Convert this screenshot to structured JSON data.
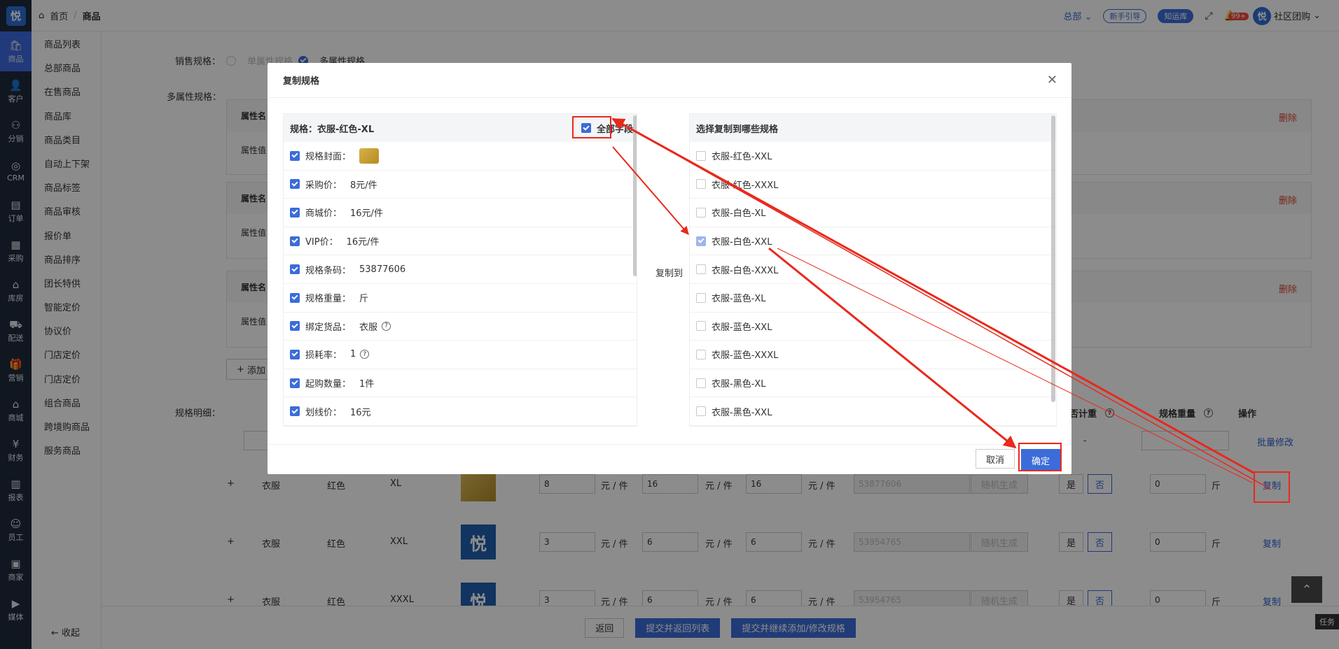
{
  "rail": {
    "logo": "悦",
    "items": [
      {
        "icon": "🛍",
        "label": "商品",
        "active": true
      },
      {
        "icon": "👤",
        "label": "客户"
      },
      {
        "icon": "⚇",
        "label": "分销"
      },
      {
        "icon": "◎",
        "label": "CRM"
      },
      {
        "icon": "▤",
        "label": "订单"
      },
      {
        "icon": "▦",
        "label": "采购"
      },
      {
        "icon": "⌂",
        "label": "库房"
      },
      {
        "icon": "⛟",
        "label": "配送"
      },
      {
        "icon": "🎁",
        "label": "营销"
      },
      {
        "icon": "⌂",
        "label": "商城"
      },
      {
        "icon": "¥",
        "label": "财务"
      },
      {
        "icon": "▥",
        "label": "报表"
      },
      {
        "icon": "☺",
        "label": "员工"
      },
      {
        "icon": "▣",
        "label": "商家"
      },
      {
        "icon": "▶",
        "label": "媒体"
      }
    ]
  },
  "subnav": {
    "items": [
      "商品列表",
      "总部商品",
      "在售商品",
      "商品库",
      "商品类目",
      "自动上下架",
      "商品标签",
      "商品审核",
      "报价单",
      "商品排序",
      "团长特供",
      "智能定价",
      "协议价",
      "门店定价",
      "门店定价",
      "组合商品",
      "跨境购商品",
      "服务商品"
    ],
    "collapse": "收起"
  },
  "topbar": {
    "crumb_home": "首页",
    "crumb_sep": "/",
    "crumb_current": "商品",
    "hq": "总部",
    "guide": "新手引导",
    "knowledge": "知运库",
    "badge": "99+",
    "store": "社区团购"
  },
  "form": {
    "sale_spec_label": "销售规格：",
    "single": "单属性规格",
    "multi": "多属性规格",
    "multi_label": "多属性规格：",
    "attr_name": "属性名",
    "attr_value": "属性值",
    "delete": "删除",
    "add": "添加",
    "detail_label": "规格明细：",
    "col_weight_by": "否计重",
    "col_weight": "规格重量",
    "col_ops": "操作",
    "batch": "批量修改"
  },
  "rows": [
    {
      "name": "衣服",
      "color": "红色",
      "size": "XL",
      "p1": "8",
      "p2": "16",
      "p3": "16",
      "unit": "元 / 件",
      "code": "53877606",
      "gen": "随机生成",
      "yes": "是",
      "no": "否",
      "weight": "0",
      "wunit": "斤",
      "op": "复制"
    },
    {
      "name": "衣服",
      "color": "红色",
      "size": "XXL",
      "p1": "3",
      "p2": "6",
      "p3": "6",
      "unit": "元 / 件",
      "code": "53954765",
      "gen": "随机生成",
      "yes": "是",
      "no": "否",
      "weight": "0",
      "wunit": "斤",
      "op": "复制"
    },
    {
      "name": "衣服",
      "color": "红色",
      "size": "XXXL",
      "p1": "3",
      "p2": "6",
      "p3": "6",
      "unit": "元 / 件",
      "code": "53954765",
      "gen": "随机生成",
      "yes": "是",
      "no": "否",
      "weight": "0",
      "wunit": "斤",
      "op": "复制"
    }
  ],
  "plus": "+",
  "dash": "-",
  "bottom": {
    "back": "返回",
    "submit_list": "提交并返回列表",
    "submit_continue": "提交并继续添加/修改规格"
  },
  "task": "任务",
  "dialog": {
    "title": "复制规格",
    "left_header": "规格：衣服-红色-XL",
    "all_fields": "全部字段",
    "copy_to": "复制到",
    "right_header": "选择复制到哪些规格",
    "fields": [
      {
        "label": "规格封面：",
        "value": "",
        "thumb": true
      },
      {
        "label": "采购价：",
        "value": "8元/件"
      },
      {
        "label": "商城价：",
        "value": "16元/件"
      },
      {
        "label": "VIP价：",
        "value": "16元/件"
      },
      {
        "label": "规格条码：",
        "value": "53877606"
      },
      {
        "label": "规格重量：",
        "value": "斤"
      },
      {
        "label": "绑定货品：",
        "value": "衣服",
        "help": true
      },
      {
        "label": "损耗率：",
        "value": "1",
        "help": true
      },
      {
        "label": "起购数量：",
        "value": "1件"
      },
      {
        "label": "划线价：",
        "value": "16元"
      }
    ],
    "targets": [
      {
        "label": "衣服-红色-XXL",
        "checked": false
      },
      {
        "label": "衣服-红色-XXXL",
        "checked": false
      },
      {
        "label": "衣服-白色-XL",
        "checked": false
      },
      {
        "label": "衣服-白色-XXL",
        "checked": true
      },
      {
        "label": "衣服-白色-XXXL",
        "checked": false
      },
      {
        "label": "衣服-蓝色-XL",
        "checked": false
      },
      {
        "label": "衣服-蓝色-XXL",
        "checked": false
      },
      {
        "label": "衣服-蓝色-XXXL",
        "checked": false
      },
      {
        "label": "衣服-黑色-XL",
        "checked": false
      },
      {
        "label": "衣服-黑色-XXL",
        "checked": false
      }
    ],
    "cancel": "取消",
    "confirm": "确定"
  },
  "colors": {
    "primary": "#3b6cd9",
    "annotation": "#e8291c",
    "rail": "#1f2a3d"
  }
}
